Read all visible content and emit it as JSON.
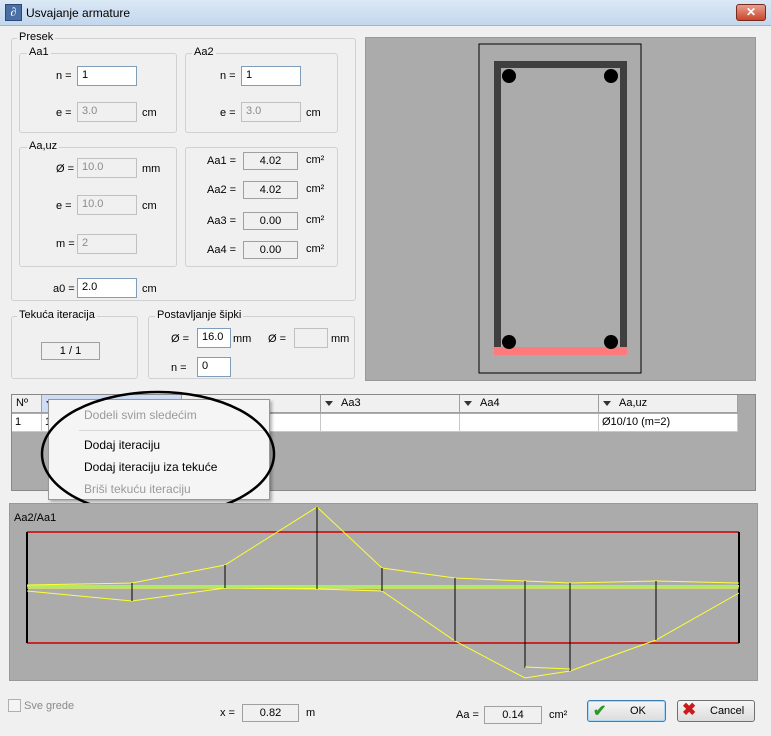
{
  "window": {
    "title": "Usvajanje armature",
    "app_icon": "∂",
    "close": "✕"
  },
  "presek": {
    "label": "Presek",
    "aa1": {
      "label": "Aa1",
      "n_label": "n =",
      "n_value": "1",
      "e_label": "e =",
      "e_value": "3.0",
      "e_unit": "cm"
    },
    "aa2": {
      "label": "Aa2",
      "n_label": "n =",
      "n_value": "1",
      "e_label": "e =",
      "e_value": "3.0",
      "e_unit": "cm"
    },
    "aauz": {
      "label": "Aa,uz",
      "d_label": "Ø =",
      "d_value": "10.0",
      "d_unit": "mm",
      "e_label": "e =",
      "e_value": "10.0",
      "e_unit": "cm",
      "m_label": "m =",
      "m_value": "2"
    },
    "areas": [
      {
        "label": "Aa1 =",
        "value": "4.02",
        "unit": "cm²"
      },
      {
        "label": "Aa2 =",
        "value": "4.02",
        "unit": "cm²"
      },
      {
        "label": "Aa3 =",
        "value": "0.00",
        "unit": "cm²"
      },
      {
        "label": "Aa4 =",
        "value": "0.00",
        "unit": "cm²"
      }
    ],
    "a0": {
      "label": "a0 =",
      "value": "2.0",
      "unit": "cm"
    }
  },
  "iteracija": {
    "label": "Tekuća iteracija",
    "value": "1 / 1"
  },
  "postavljanje": {
    "label": "Postavljanje šipki",
    "d_label": "Ø =",
    "d_value": "16.0",
    "d_unit": "mm",
    "d2_label": "Ø =",
    "d2_unit": "mm",
    "n_label": "n =",
    "n_value": "0"
  },
  "grid": {
    "headers": [
      "Nº",
      "",
      "",
      "Aa3",
      "Aa4",
      "Aa,uz"
    ],
    "row": {
      "no": "1",
      "first": "1",
      "aauz": "Ø10/10 (m=2)"
    }
  },
  "context_menu": {
    "items": [
      {
        "label": "Dodeli svim sledećim",
        "enabled": false
      },
      {
        "label": "Dodaj iteraciju",
        "enabled": true
      },
      {
        "label": "Dodaj iteraciju iza tekuće",
        "enabled": true
      },
      {
        "label": "Briši tekuću iteraciju",
        "enabled": false
      }
    ]
  },
  "diagram": {
    "label": "Aa2/Aa1"
  },
  "footer": {
    "sve_grede": "Sve grede",
    "x_label": "x =",
    "x_value": "0.82",
    "x_unit": "m",
    "aa_label": "Aa =",
    "aa_value": "0.14",
    "aa_unit": "cm²",
    "ok": "OK",
    "cancel": "Cancel"
  },
  "colors": {
    "accent_red": "#cc0000",
    "line_yellow": "#ffff33",
    "axis_green": "#aaee66",
    "rebar_pink": "#ff7b7b"
  }
}
